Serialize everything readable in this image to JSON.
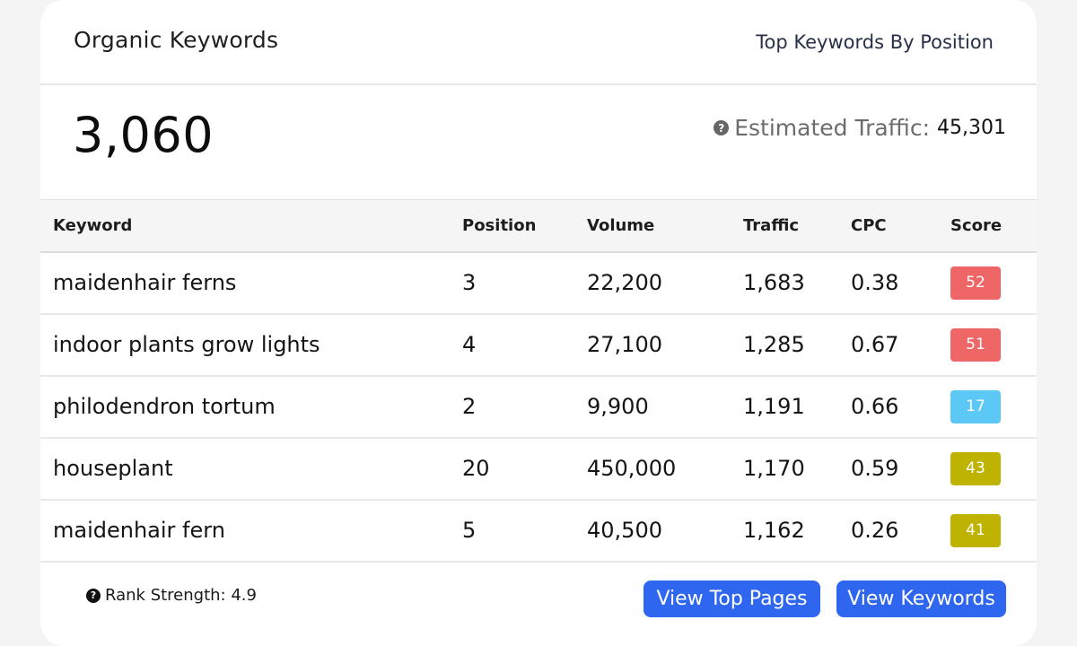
{
  "card": {
    "title": "Organic Keywords",
    "top_link": "Top Keywords By Position"
  },
  "summary": {
    "total_keywords": "3,060",
    "help_icon": "question-circle-icon",
    "traffic_label": "Estimated Traffic:",
    "traffic_value": "45,301"
  },
  "table": {
    "headers": [
      "Keyword",
      "Position",
      "Volume",
      "Traffic",
      "CPC",
      "Score"
    ],
    "rows": [
      {
        "keyword": "maidenhair ferns",
        "position": "3",
        "volume": "22,200",
        "traffic": "1,683",
        "cpc": "0.38",
        "score": "52",
        "score_color": "#ee6666"
      },
      {
        "keyword": "indoor plants grow lights",
        "position": "4",
        "volume": "27,100",
        "traffic": "1,285",
        "cpc": "0.67",
        "score": "51",
        "score_color": "#ee6666"
      },
      {
        "keyword": "philodendron tortum",
        "position": "2",
        "volume": "9,900",
        "traffic": "1,191",
        "cpc": "0.66",
        "score": "17",
        "score_color": "#5bc8f5"
      },
      {
        "keyword": "houseplant",
        "position": "20",
        "volume": "450,000",
        "traffic": "1,170",
        "cpc": "0.59",
        "score": "43",
        "score_color": "#bdb300"
      },
      {
        "keyword": "maidenhair fern",
        "position": "5",
        "volume": "40,500",
        "traffic": "1,162",
        "cpc": "0.26",
        "score": "41",
        "score_color": "#bdb300"
      }
    ]
  },
  "footer": {
    "rank_strength": "Rank Strength: 4.9",
    "view_top_pages": "View Top Pages",
    "view_keywords": "View Keywords"
  },
  "colors": {
    "accent": "#2f66ef",
    "score_high": "#ee6666",
    "score_low": "#5bc8f5",
    "score_mid": "#bdb300"
  }
}
